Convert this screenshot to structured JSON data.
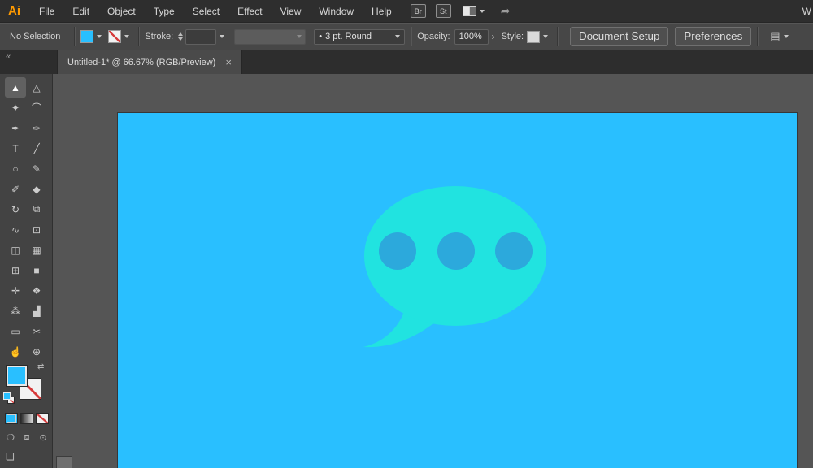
{
  "menubar": {
    "logo": "Ai",
    "items": [
      "File",
      "Edit",
      "Object",
      "Type",
      "Select",
      "Effect",
      "View",
      "Window",
      "Help"
    ],
    "bridge_button": "Br",
    "stock_button": "St",
    "share_glyph": "➦",
    "right_partial": "W"
  },
  "control_bar": {
    "selection_status": "No Selection",
    "stroke_label": "Stroke:",
    "brush_bullet": "•",
    "brush_name": "3 pt. Round",
    "opacity_label": "Opacity:",
    "opacity_value": "100%",
    "opacity_more_glyph": "›",
    "style_label": "Style:",
    "document_setup_button": "Document Setup",
    "preferences_button": "Preferences",
    "panel_icon_glyph": "▤"
  },
  "tab": {
    "title": "Untitled-1* @ 66.67% (RGB/Preview)",
    "close_glyph": "×"
  },
  "toolbar": {
    "collapse_glyph": "«",
    "swap_glyph": "⇄",
    "drawing_mode_glyphs": [
      "❍",
      "⧈",
      "⊙"
    ],
    "screen_mode_glyph": "❏",
    "tools": [
      {
        "name": "selection-tool",
        "glyph": "▲",
        "selected": true
      },
      {
        "name": "direct-selection-tool",
        "glyph": "△"
      },
      {
        "name": "magic-wand-tool",
        "glyph": "✦"
      },
      {
        "name": "lasso-tool",
        "glyph": "⌒"
      },
      {
        "name": "pen-tool",
        "glyph": "✒"
      },
      {
        "name": "curvature-tool",
        "glyph": "✑"
      },
      {
        "name": "type-tool",
        "glyph": "T"
      },
      {
        "name": "line-segment-tool",
        "glyph": "╱"
      },
      {
        "name": "ellipse-tool",
        "glyph": "○"
      },
      {
        "name": "paintbrush-tool",
        "glyph": "✎"
      },
      {
        "name": "shaper-tool",
        "glyph": "✐"
      },
      {
        "name": "eraser-tool",
        "glyph": "◆"
      },
      {
        "name": "rotate-tool",
        "glyph": "↻"
      },
      {
        "name": "scale-tool",
        "glyph": "⧉"
      },
      {
        "name": "width-tool",
        "glyph": "∿"
      },
      {
        "name": "free-transform-tool",
        "glyph": "⊡"
      },
      {
        "name": "shape-builder-tool",
        "glyph": "◫"
      },
      {
        "name": "perspective-grid-tool",
        "glyph": "▦"
      },
      {
        "name": "mesh-tool",
        "glyph": "⊞"
      },
      {
        "name": "gradient-tool",
        "glyph": "■"
      },
      {
        "name": "eyedropper-tool",
        "glyph": "✛"
      },
      {
        "name": "blend-tool",
        "glyph": "❖"
      },
      {
        "name": "symbol-sprayer-tool",
        "glyph": "⁂"
      },
      {
        "name": "column-graph-tool",
        "glyph": "▟"
      },
      {
        "name": "artboard-tool",
        "glyph": "▭"
      },
      {
        "name": "slice-tool",
        "glyph": "✂"
      },
      {
        "name": "hand-tool",
        "glyph": "☝"
      },
      {
        "name": "zoom-tool",
        "glyph": "⊕"
      }
    ]
  },
  "canvas": {
    "artboard_color": "#29BFFF",
    "bubble_color": "#21E3E0",
    "dot_color": "#2CA9DC"
  }
}
